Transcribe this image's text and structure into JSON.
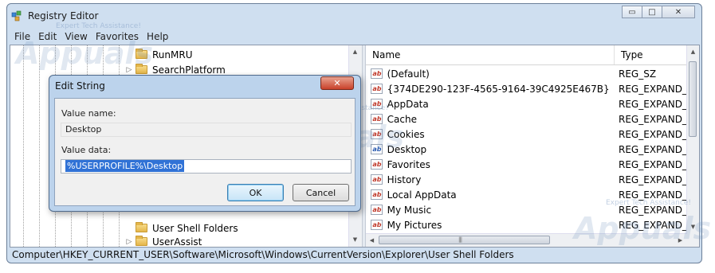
{
  "window": {
    "title": "Registry Editor",
    "caption_buttons": {
      "minimize": "▭",
      "maximize": "□",
      "close": "✕"
    }
  },
  "menu": [
    "File",
    "Edit",
    "View",
    "Favorites",
    "Help"
  ],
  "tree": {
    "items": [
      {
        "label": "RunMRU",
        "expander": ""
      },
      {
        "label": "SearchPlatform",
        "expander": "▷"
      },
      {
        "label": "User Shell Folders",
        "expander": ""
      },
      {
        "label": "UserAssist",
        "expander": "▷"
      }
    ]
  },
  "list": {
    "columns": {
      "name": "Name",
      "type": "Type"
    },
    "rows": [
      {
        "name": "(Default)",
        "type": "REG_SZ",
        "icon": "string-value-icon"
      },
      {
        "name": "{374DE290-123F-4565-9164-39C4925E467B}",
        "type": "REG_EXPAND_SZ",
        "icon": "string-value-icon"
      },
      {
        "name": "AppData",
        "type": "REG_EXPAND_SZ",
        "icon": "string-value-icon"
      },
      {
        "name": "Cache",
        "type": "REG_EXPAND_SZ",
        "icon": "string-value-icon"
      },
      {
        "name": "Cookies",
        "type": "REG_EXPAND_SZ",
        "icon": "string-value-icon"
      },
      {
        "name": "Desktop",
        "type": "REG_EXPAND_SZ",
        "icon": "binary-value-icon"
      },
      {
        "name": "Favorites",
        "type": "REG_EXPAND_SZ",
        "icon": "string-value-icon"
      },
      {
        "name": "History",
        "type": "REG_EXPAND_SZ",
        "icon": "string-value-icon"
      },
      {
        "name": "Local AppData",
        "type": "REG_EXPAND_SZ",
        "icon": "string-value-icon"
      },
      {
        "name": "My Music",
        "type": "REG_EXPAND_SZ",
        "icon": "string-value-icon"
      },
      {
        "name": "My Pictures",
        "type": "REG_EXPAND_SZ",
        "icon": "string-value-icon"
      }
    ]
  },
  "statusbar": {
    "path": "Computer\\HKEY_CURRENT_USER\\Software\\Microsoft\\Windows\\CurrentVersion\\Explorer\\User Shell Folders"
  },
  "dialog": {
    "title": "Edit String",
    "value_name_label": "Value name:",
    "value_name": "Desktop",
    "value_data_label": "Value data:",
    "value_data": "%USERPROFILE%\\Desktop",
    "ok_label": "OK",
    "cancel_label": "Cancel",
    "close_glyph": "✕"
  },
  "watermark": {
    "text": "Appuals",
    "tagline": "Expert Tech Assistance!"
  }
}
